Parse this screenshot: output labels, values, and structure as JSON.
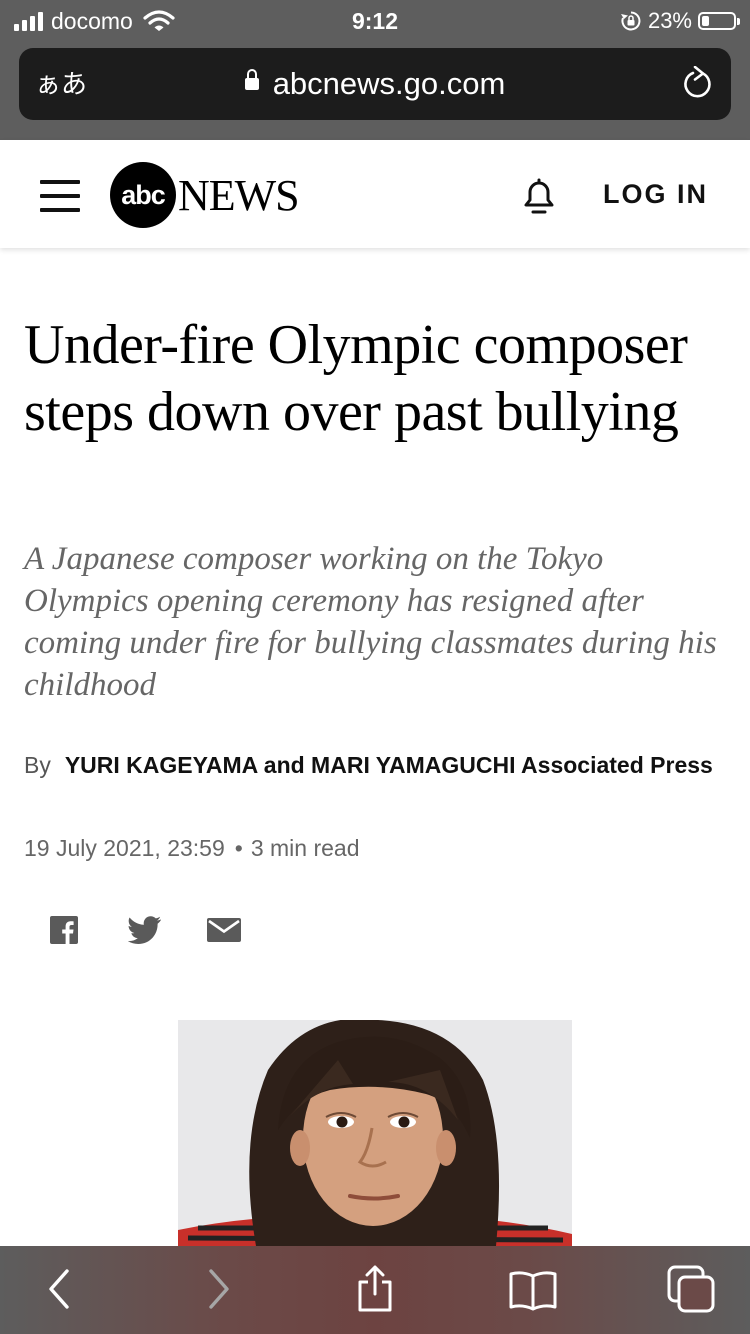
{
  "status_bar": {
    "carrier": "docomo",
    "time": "9:12",
    "battery": "23%",
    "battery_level": 0.23,
    "icons": [
      "signal-icon",
      "wifi-icon",
      "rotation-lock-icon",
      "battery-icon"
    ]
  },
  "browser": {
    "text_size_label": "ぁあ",
    "url": "abcnews.go.com",
    "icons": [
      "lock-icon",
      "reload-icon"
    ]
  },
  "site_header": {
    "logo_abc": "abc",
    "logo_news": "NEWS",
    "login_label": "LOG IN",
    "icons": [
      "menu-icon",
      "bell-icon"
    ]
  },
  "article": {
    "headline": "Under-fire Olympic composer steps down over past bullying",
    "dek": "A Japanese composer working on the Tokyo Olympics opening ceremony has resigned after coming under fire for bullying classmates during his childhood",
    "by_prefix": "By",
    "authors": "YURI KAGEYAMA and MARI YAMAGUCHI Associated Press",
    "date": "19 July 2021, 23:59",
    "separator": "•",
    "read_time": "3 min read",
    "share_icons": [
      "facebook-icon",
      "twitter-icon",
      "email-icon"
    ]
  },
  "toolbar": {
    "icons": [
      "back-icon",
      "forward-icon",
      "share-icon",
      "bookmarks-icon",
      "tabs-icon"
    ]
  },
  "colors": {
    "status_bar_bg": "#5e5e5e",
    "url_bar_bg": "#1c1c1c",
    "headline_text": "#000000",
    "dek_text": "#666666",
    "share_icon": "#5a5a5a",
    "photo_shirt_red": "#c8302a"
  }
}
